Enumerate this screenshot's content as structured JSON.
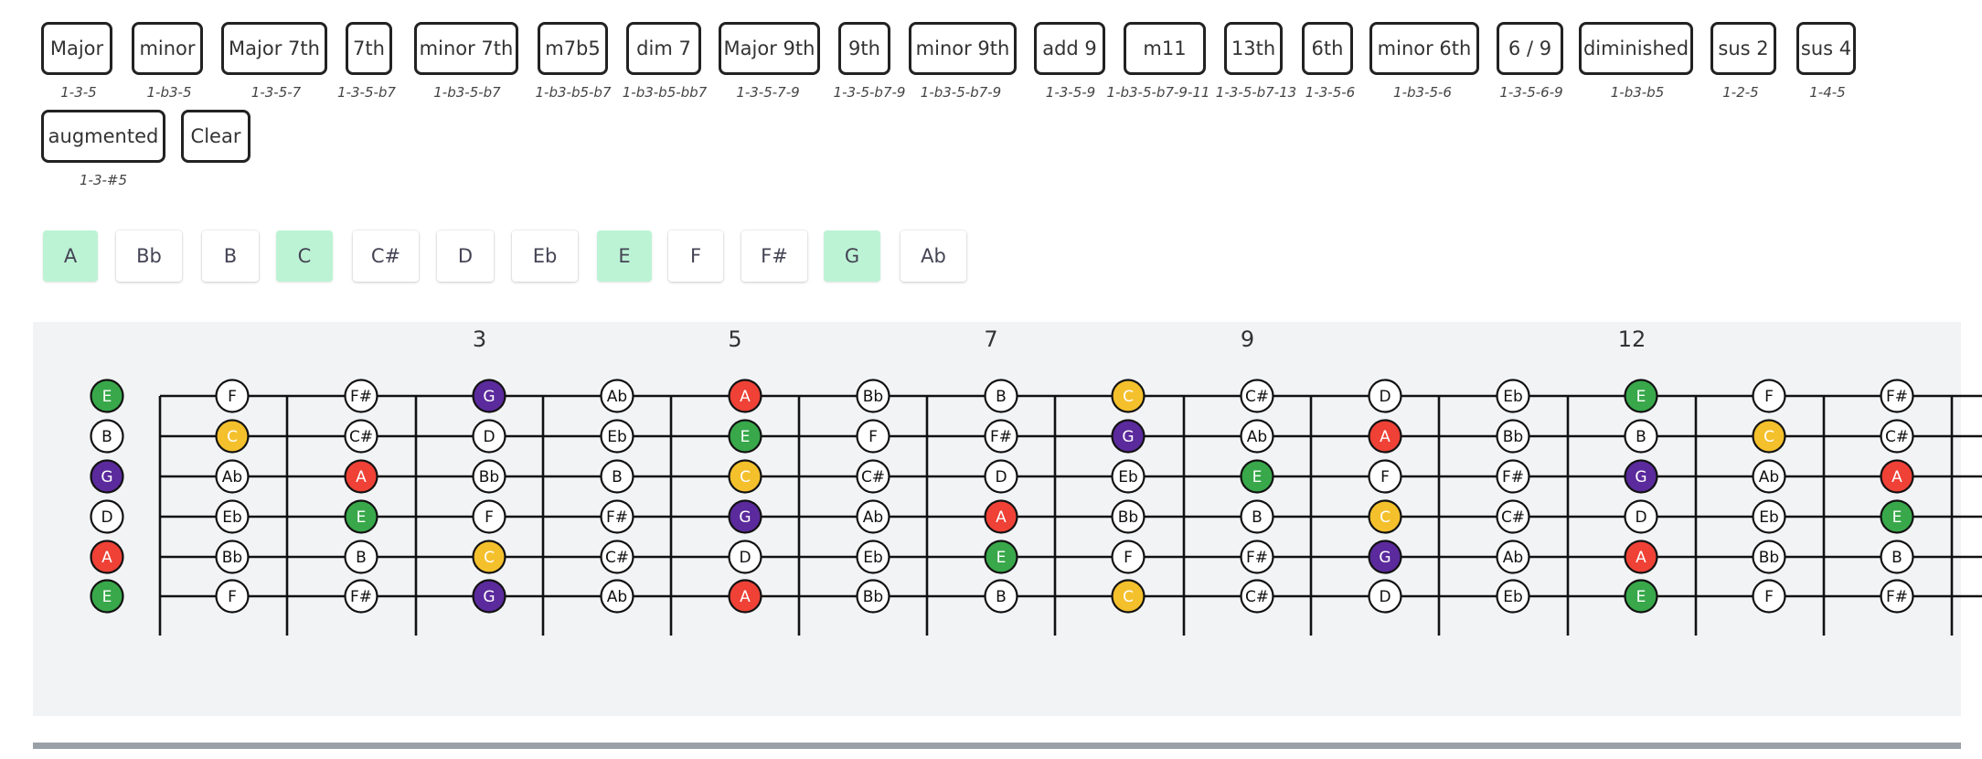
{
  "chords": [
    {
      "label": "Major",
      "formula": "1-3-5"
    },
    {
      "label": "minor",
      "formula": "1-b3-5"
    },
    {
      "label": "Major 7th",
      "formula": "1-3-5-7"
    },
    {
      "label": "7th",
      "formula": "1-3-5-b7"
    },
    {
      "label": "minor 7th",
      "formula": "1-b3-5-b7"
    },
    {
      "label": "m7b5",
      "formula": "1-b3-b5-b7"
    },
    {
      "label": "dim 7",
      "formula": "1-b3-b5-bb7"
    },
    {
      "label": "Major 9th",
      "formula": "1-3-5-7-9"
    },
    {
      "label": "9th",
      "formula": "1-3-5-b7-9"
    },
    {
      "label": "minor 9th",
      "formula": "1-b3-5-b7-9"
    },
    {
      "label": "add 9",
      "formula": "1-3-5-9"
    },
    {
      "label": "m11",
      "formula": "1-b3-5-b7-9-11"
    },
    {
      "label": "13th",
      "formula": "1-3-5-b7-13"
    },
    {
      "label": "6th",
      "formula": "1-3-5-6"
    },
    {
      "label": "minor 6th",
      "formula": "1-b3-5-6"
    },
    {
      "label": "6 / 9",
      "formula": "1-3-5-6-9"
    },
    {
      "label": "diminished",
      "formula": "1-b3-b5"
    },
    {
      "label": "sus 2",
      "formula": "1-2-5"
    },
    {
      "label": "sus 4",
      "formula": "1-4-5"
    },
    {
      "label": "augmented",
      "formula": "1-3-#5"
    },
    {
      "label": "Clear",
      "formula": ""
    }
  ],
  "root_notes": [
    {
      "label": "A",
      "active": true
    },
    {
      "label": "Bb",
      "active": false
    },
    {
      "label": "B",
      "active": false
    },
    {
      "label": "C",
      "active": true
    },
    {
      "label": "C#",
      "active": false
    },
    {
      "label": "D",
      "active": false
    },
    {
      "label": "Eb",
      "active": false
    },
    {
      "label": "E",
      "active": true
    },
    {
      "label": "F",
      "active": false
    },
    {
      "label": "F#",
      "active": false
    },
    {
      "label": "G",
      "active": true
    },
    {
      "label": "Ab",
      "active": false
    }
  ],
  "fretboard": {
    "fret_markers": [
      "3",
      "5",
      "7",
      "9",
      "12"
    ],
    "strings": [
      [
        "E",
        "F",
        "F#",
        "G",
        "Ab",
        "A",
        "Bb",
        "B",
        "C",
        "C#",
        "D",
        "Eb",
        "E",
        "F",
        "F#"
      ],
      [
        "B",
        "C",
        "C#",
        "D",
        "Eb",
        "E",
        "F",
        "F#",
        "G",
        "Ab",
        "A",
        "Bb",
        "B",
        "C",
        "C#"
      ],
      [
        "G",
        "Ab",
        "A",
        "Bb",
        "B",
        "C",
        "C#",
        "D",
        "Eb",
        "E",
        "F",
        "F#",
        "G",
        "Ab",
        "A"
      ],
      [
        "D",
        "Eb",
        "E",
        "F",
        "F#",
        "G",
        "Ab",
        "A",
        "Bb",
        "B",
        "C",
        "C#",
        "D",
        "Eb",
        "E"
      ],
      [
        "A",
        "Bb",
        "B",
        "C",
        "C#",
        "D",
        "Eb",
        "E",
        "F",
        "F#",
        "G",
        "Ab",
        "A",
        "Bb",
        "B"
      ],
      [
        "E",
        "F",
        "F#",
        "G",
        "Ab",
        "A",
        "Bb",
        "B",
        "C",
        "C#",
        "D",
        "Eb",
        "E",
        "F",
        "F#"
      ]
    ],
    "note_colors": {
      "A": "#ef4136",
      "C": "#f4c02c",
      "E": "#38a84a",
      "G": "#5b2a9c"
    }
  }
}
